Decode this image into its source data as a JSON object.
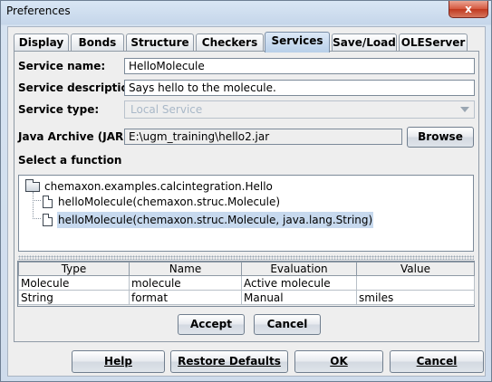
{
  "window": {
    "title": "Preferences",
    "close_glyph": "x"
  },
  "tabs": [
    {
      "label": "Display",
      "selected": false
    },
    {
      "label": "Bonds",
      "selected": false
    },
    {
      "label": "Structure",
      "selected": false
    },
    {
      "label": "Checkers",
      "selected": false
    },
    {
      "label": "Services",
      "selected": true
    },
    {
      "label": "Save/Load",
      "selected": false
    },
    {
      "label": "OLEServer",
      "selected": false
    }
  ],
  "form": {
    "service_name_label": "Service name:",
    "service_name_value": "HelloMolecule",
    "service_description_label": "Service description:",
    "service_description_value": "Says hello to the molecule.",
    "service_type_label": "Service type:",
    "service_type_value": "Local Service",
    "jar_label": "Java Archive (JAR):",
    "jar_value": "E:\\ugm_training\\hello2.jar",
    "browse_label": "Browse",
    "select_function_label": "Select a function"
  },
  "tree": {
    "root": "chemaxon.examples.calcintegration.Hello",
    "children": [
      {
        "label": "helloMolecule(chemaxon.struc.Molecule)",
        "selected": false
      },
      {
        "label": "helloMolecule(chemaxon.struc.Molecule, java.lang.String)",
        "selected": true
      }
    ]
  },
  "params_table": {
    "headers": [
      "Type",
      "Name",
      "Evaluation",
      "Value"
    ],
    "rows": [
      [
        "Molecule",
        "molecule",
        "Active molecule",
        ""
      ],
      [
        "String",
        "format",
        "Manual",
        "smiles"
      ]
    ]
  },
  "panel_buttons": {
    "accept": "Accept",
    "cancel": "Cancel"
  },
  "dialog_buttons": {
    "help": "Help",
    "restore_defaults": "Restore Defaults",
    "ok": "OK",
    "cancel": "Cancel"
  },
  "colors": {
    "selected_tab": "#b8cfe9",
    "tree_selection": "#c7d9ee",
    "close_button": "#c0391f"
  }
}
